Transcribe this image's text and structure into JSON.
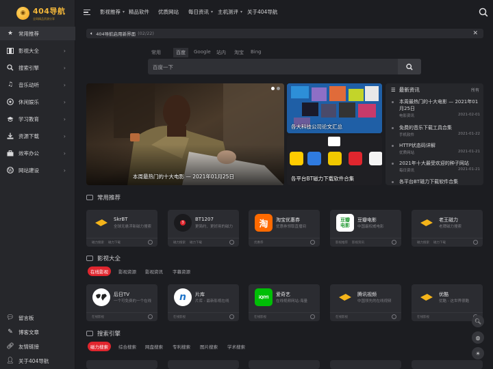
{
  "logo": {
    "text": "404导航",
    "sub": "全网精品资源分享"
  },
  "sidebar": {
    "items": [
      {
        "label": "常用推荐",
        "icon": "star-icon"
      },
      {
        "label": "影视大全",
        "icon": "film-icon"
      },
      {
        "label": "搜索引擎",
        "icon": "search-icon"
      },
      {
        "label": "音乐动听",
        "icon": "music-icon"
      },
      {
        "label": "休闲娱乐",
        "icon": "chrome-icon"
      },
      {
        "label": "学习教育",
        "icon": "graduation-cap-icon"
      },
      {
        "label": "资源下载",
        "icon": "download-icon"
      },
      {
        "label": "效率办公",
        "icon": "briefcase-icon"
      },
      {
        "label": "网站建设",
        "icon": "wordpress-icon"
      }
    ],
    "bottom": [
      {
        "label": "留言板",
        "icon": "comment-icon"
      },
      {
        "label": "博客文章",
        "icon": "blog-icon"
      },
      {
        "label": "友情链接",
        "icon": "link-icon"
      },
      {
        "label": "关于404导航",
        "icon": "user-icon"
      }
    ]
  },
  "topnav": {
    "links": [
      "影视推荐",
      "精品软件",
      "优质网站",
      "每日资讯",
      "主机测评",
      "关于404导航"
    ],
    "dropdown": [
      true,
      false,
      false,
      true,
      true,
      false
    ]
  },
  "notice": {
    "text": "404导航启用新界面",
    "date": "(02/22)"
  },
  "search": {
    "tabs": [
      "常用",
      "百度",
      "Google",
      "站内",
      "淘宝",
      "Bing"
    ],
    "placeholder": "百度一下"
  },
  "hero": {
    "caption": "本周最热门的十大电影 — 2021年01月25日"
  },
  "tiles": [
    {
      "caption": "各大科技公司论文汇总"
    },
    {
      "caption": "各平台BT磁力下载软件合集"
    }
  ],
  "news": {
    "title": "最新资讯",
    "all": "所有",
    "items": [
      {
        "title": "本周最热门的十大电影 — 2021年01月25日",
        "cat": "电影资讯",
        "date": "2021-02-01"
      },
      {
        "title": "免费的音乐下载工具合集",
        "cat": "手机软件",
        "date": "2021-01-22"
      },
      {
        "title": "HTTP状态码详解",
        "cat": "优质网站",
        "date": "2021-01-21"
      },
      {
        "title": "2021年十大最受欢迎的种子网站",
        "cat": "每日资讯",
        "date": "2021-01-21"
      },
      {
        "title": "各平台BT磁力下载软件合集",
        "cat": "",
        "date": ""
      }
    ]
  },
  "sections": {
    "common": {
      "title": "常用推荐",
      "cards": [
        {
          "name": "SkrBT",
          "desc": "全球无悬浮新磁力搜索",
          "tags": [
            "磁力搜索",
            "磁力下载"
          ],
          "icon": "diamond"
        },
        {
          "name": "BT1207",
          "desc": "更简约、更好用的磁力",
          "tags": [
            "磁力搜索",
            "磁力下载"
          ],
          "icon": "bt"
        },
        {
          "name": "淘宝优惠券",
          "desc": "优惠券领取直播间",
          "tags": [
            "优惠券"
          ],
          "icon": "taobao"
        },
        {
          "name": "豆瓣电影",
          "desc": "中国最权威电影",
          "tags": [
            "影视推荐",
            "影视资讯"
          ],
          "icon": "douban"
        },
        {
          "name": "老王磁力",
          "desc": "老牌磁力搜索",
          "tags": [
            "磁力搜索",
            "磁力下载"
          ],
          "icon": "diamond"
        }
      ]
    },
    "video": {
      "title": "影视大全",
      "chips": [
        "在线影视",
        "影视资源",
        "影视资讯",
        "字幕资源"
      ],
      "cards": [
        {
          "name": "后日TV",
          "desc": "一个可免费的一个在线",
          "tags": [
            "在线影视"
          ],
          "icon": "houri"
        },
        {
          "name": "片库",
          "desc": "片库 - 最新影视在线",
          "tags": [
            "在线影视"
          ],
          "icon": "pianku"
        },
        {
          "name": "爱奇艺",
          "desc": "在线视频网站-海量",
          "tags": [
            "在线影视"
          ],
          "icon": "iqiyi"
        },
        {
          "name": "腾讯视频",
          "desc": "中国领先的在线视频",
          "tags": [
            "在线影视"
          ],
          "icon": "diamond"
        },
        {
          "name": "优酷",
          "desc": "优酷 - 这世界很酷",
          "tags": [
            "在线影视"
          ],
          "icon": "diamond"
        }
      ]
    },
    "search": {
      "title": "搜索引擎",
      "chips": [
        "磁力搜索",
        "综合搜索",
        "网盘搜索",
        "专利搜索",
        "图片搜索",
        "学术搜索"
      ]
    }
  },
  "colors": {
    "accent": "#e0262e",
    "brand": "#f3b73a",
    "bg": "#1c1d21",
    "sidebar": "#26272b",
    "card": "#2b2c31"
  }
}
